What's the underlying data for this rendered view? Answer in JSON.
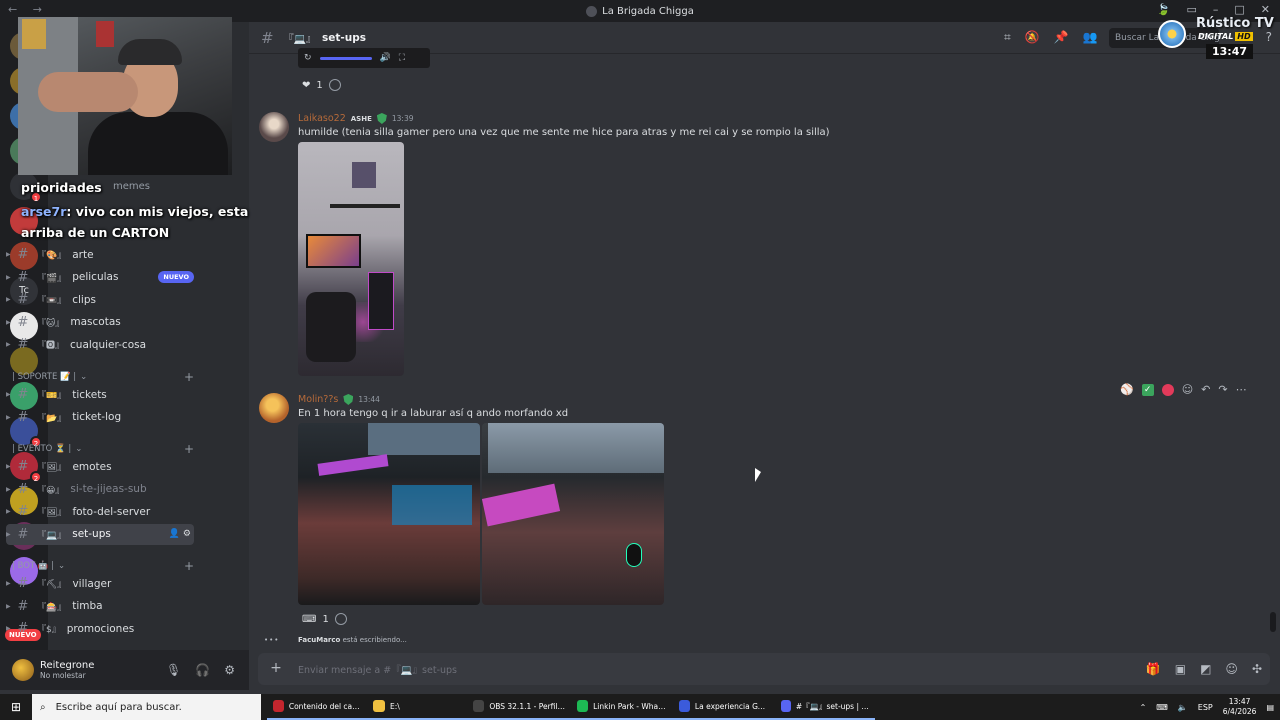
{
  "window": {
    "title": "La Brigada Chigga"
  },
  "channel": {
    "hash": "#",
    "bracket": "『💻』",
    "name": "set-ups",
    "search_placeholder": "Buscar La Brigada Chigga"
  },
  "overlay": {
    "tv_brand": "Rústico TV",
    "tv_digital": "DIGITAL",
    "tv_hd": "HD",
    "tv_clock": "13:47",
    "chat_line1": "prioridades",
    "chat_user": "arse7r",
    "chat_line2_rest": ": vivo con mis viejos, esta",
    "chat_line3": "arriba de un CARTON",
    "ghost_memes": "memes"
  },
  "servers": [
    {
      "badge": ""
    },
    {
      "badge": "11"
    },
    {
      "badge": ""
    },
    {
      "badge": ""
    },
    {
      "badge": "1"
    },
    {
      "badge": ""
    },
    {
      "badge": ""
    },
    {
      "badge": "Tc"
    },
    {
      "badge": ""
    },
    {
      "badge": ""
    },
    {
      "badge": ""
    },
    {
      "badge": "2"
    },
    {
      "badge": "2"
    },
    {
      "badge": ""
    },
    {
      "badge": ""
    },
    {
      "badge": ""
    }
  ],
  "server_nuevo": "NUEVO",
  "sidebar": {
    "channels_top": [
      {
        "bracket": "『🎨』",
        "name": "arte"
      },
      {
        "bracket": "『🎬』",
        "name": "peliculas",
        "badge": "NUEVO"
      },
      {
        "bracket": "『📼』",
        "name": "clips"
      },
      {
        "bracket": "『🐱』",
        "name": "mascotas"
      },
      {
        "bracket": "『🅾』",
        "name": "cualquier-cosa"
      }
    ],
    "cat_soporte": "| SOPORTE 📝 |",
    "channels_soporte": [
      {
        "bracket": "『🎫』",
        "name": "tickets"
      },
      {
        "bracket": "『📂』",
        "name": "ticket-log"
      }
    ],
    "cat_evento": "| EVENTO ⏳ |",
    "channels_evento": [
      {
        "bracket": "『🖼』",
        "name": "emotes"
      },
      {
        "bracket": "『😀』",
        "name": "si-te-jijeas-sub"
      },
      {
        "bracket": "『🖼』",
        "name": "foto-del-server"
      },
      {
        "bracket": "『💻』",
        "name": "set-ups"
      }
    ],
    "cat_bot": "| BOT 🤖 |",
    "channels_bot": [
      {
        "bracket": "『⛏』",
        "name": "villager"
      },
      {
        "bracket": "『🎰』",
        "name": "timba"
      },
      {
        "bracket": "『$』",
        "name": "promociones"
      }
    ]
  },
  "user": {
    "name": "Reitegrone",
    "status": "No molestar"
  },
  "messages": {
    "prev_reaction_count": "1",
    "msg1": {
      "author": "Laikaso22",
      "tag": "ASHE",
      "time": "13:39",
      "text": "humilde (tenia silla gamer pero una vez que me sente me hice para atras y me rei cai y se rompio la silla)"
    },
    "msg2": {
      "author": "Molin??s",
      "time": "13:44",
      "text": "En 1 hora tengo q ir a laburar así q ando morfando xd",
      "reaction_count": "1"
    },
    "typing_user": "FacuMarco",
    "typing_text": "está escribiendo..."
  },
  "composer": {
    "placeholder": "Enviar mensaje a #『💻』set-ups"
  },
  "taskbar": {
    "search": "Escribe aquí para buscar.",
    "tasks": [
      {
        "label": "Contenido del cana...",
        "color": "#c4262e"
      },
      {
        "label": "E:\\",
        "color": "#f0c040"
      },
      {
        "label": "OBS 32.1.1 - Perfil: ...",
        "color": "#444"
      },
      {
        "label": "Linkin Park - What I...",
        "color": "#1db954"
      },
      {
        "label": "La experiencia GTA ...",
        "color": "#3b5bdb"
      },
      {
        "label": "#『💻』set-ups | La B...",
        "color": "#5865f2"
      }
    ],
    "lang": "ESP",
    "time": "13:47",
    "date": "6/4/2026"
  }
}
